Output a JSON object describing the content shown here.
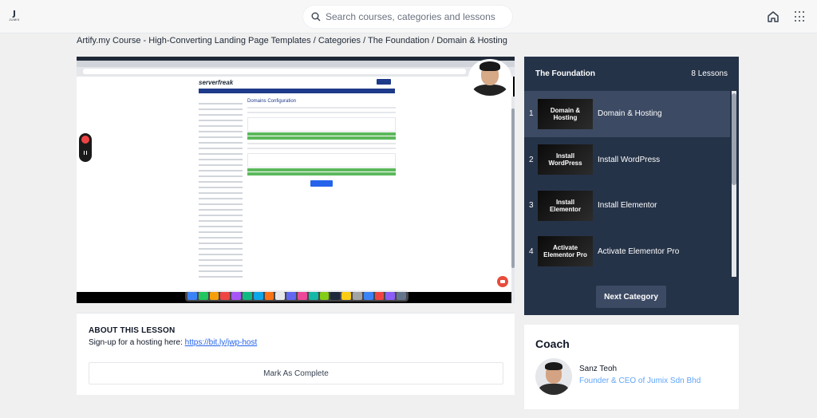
{
  "header": {
    "logo_mark": "J",
    "logo_word": "JUMIX",
    "search_placeholder": "Search courses, categories and lessons"
  },
  "breadcrumb": "Artify.my Course - High-Converting Landing Page Templates / Categories / The Foundation / Domain & Hosting",
  "video": {
    "site_logo": "serverfreak",
    "page_heading": "Domains Configuration"
  },
  "about": {
    "title": "ABOUT THIS LESSON",
    "text": "Sign-up for a hosting here: ",
    "link": "https://bit.ly/jwp-host",
    "complete_label": "Mark As Complete"
  },
  "lessons": {
    "category": "The Foundation",
    "count": "8 Lessons",
    "items": [
      {
        "num": "1",
        "thumb_line1": "Domain &",
        "thumb_line2": "Hosting",
        "name": "Domain & Hosting"
      },
      {
        "num": "2",
        "thumb_line1": "Install",
        "thumb_line2": "WordPress",
        "name": "Install WordPress"
      },
      {
        "num": "3",
        "thumb_line1": "Install",
        "thumb_line2": "Elementor",
        "name": "Install Elementor"
      },
      {
        "num": "4",
        "thumb_line1": "Activate",
        "thumb_line2": "Elementor Pro",
        "name": "Activate Elementor Pro"
      }
    ],
    "next_label": "Next Category"
  },
  "coach": {
    "title": "Coach",
    "name": "Sanz Teoh",
    "role": "Founder & CEO of Jumix Sdn Bhd"
  }
}
